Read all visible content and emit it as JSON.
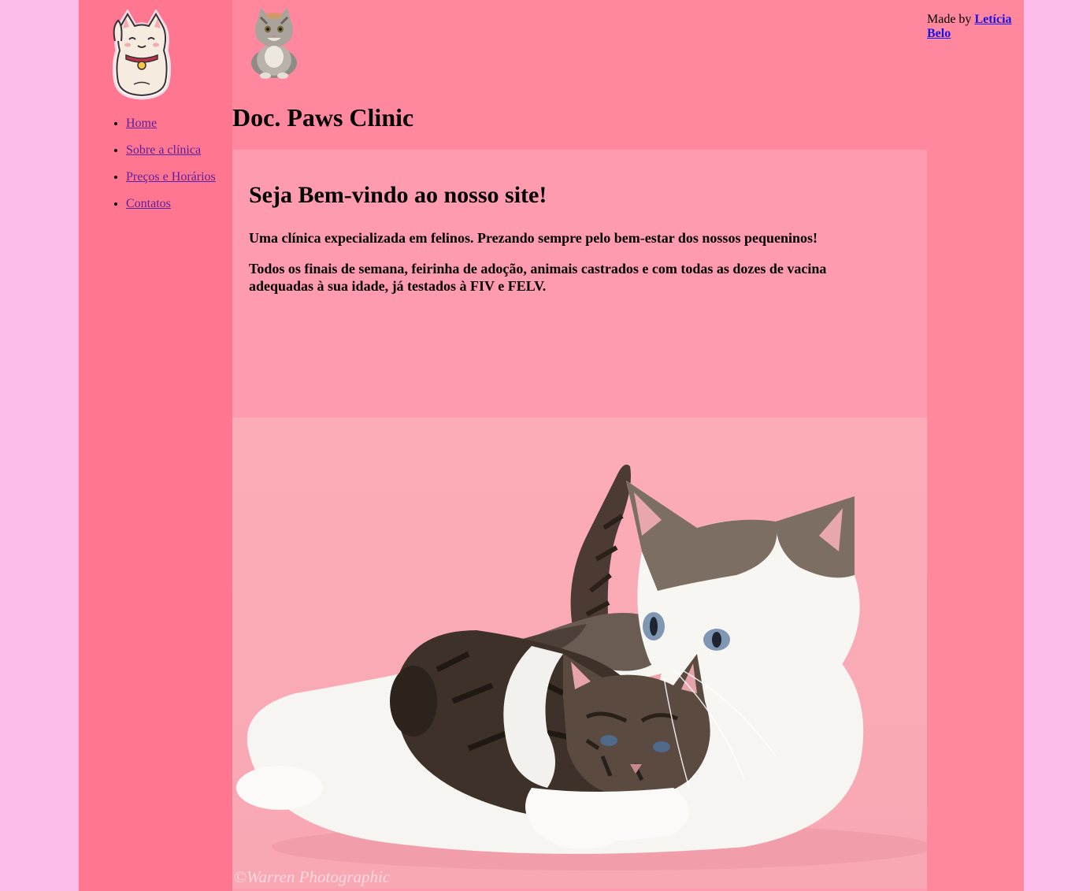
{
  "brand": {
    "logo_icon": "lucky-cat-icon",
    "header_icon": "cat-photo-icon"
  },
  "nav": {
    "items": [
      {
        "label": "Home"
      },
      {
        "label": "Sobre a clínica"
      },
      {
        "label": "Preços e Horários"
      },
      {
        "label": "Contatos"
      }
    ]
  },
  "header": {
    "title": "Doc. Paws Clinic"
  },
  "credit": {
    "prefix": "Made by ",
    "author": "Letícia Belo"
  },
  "main": {
    "heading": "Seja Bem-vindo ao nosso site!",
    "paragraph1": "Uma clínica expecializada em felinos. Prezando sempre pelo bem-estar dos nossos pequeninos!",
    "paragraph2": "Todos os finais de semana, feirinha de adoção, animais castrados e com todas as dozes de vacina adequadas à sua idade, já testados à FIV e FELV."
  },
  "photo": {
    "watermark": "©Warren Photographic",
    "subject": "cat-and-kitten-photo"
  },
  "colors": {
    "outer_bg": "#fdbdea",
    "page_bg": "#ff879e",
    "sidebar_bg": "#ff7690",
    "main_bg": "#ff9bae",
    "nav_link": "#5b1fa0",
    "credit_link": "#1414e6"
  }
}
